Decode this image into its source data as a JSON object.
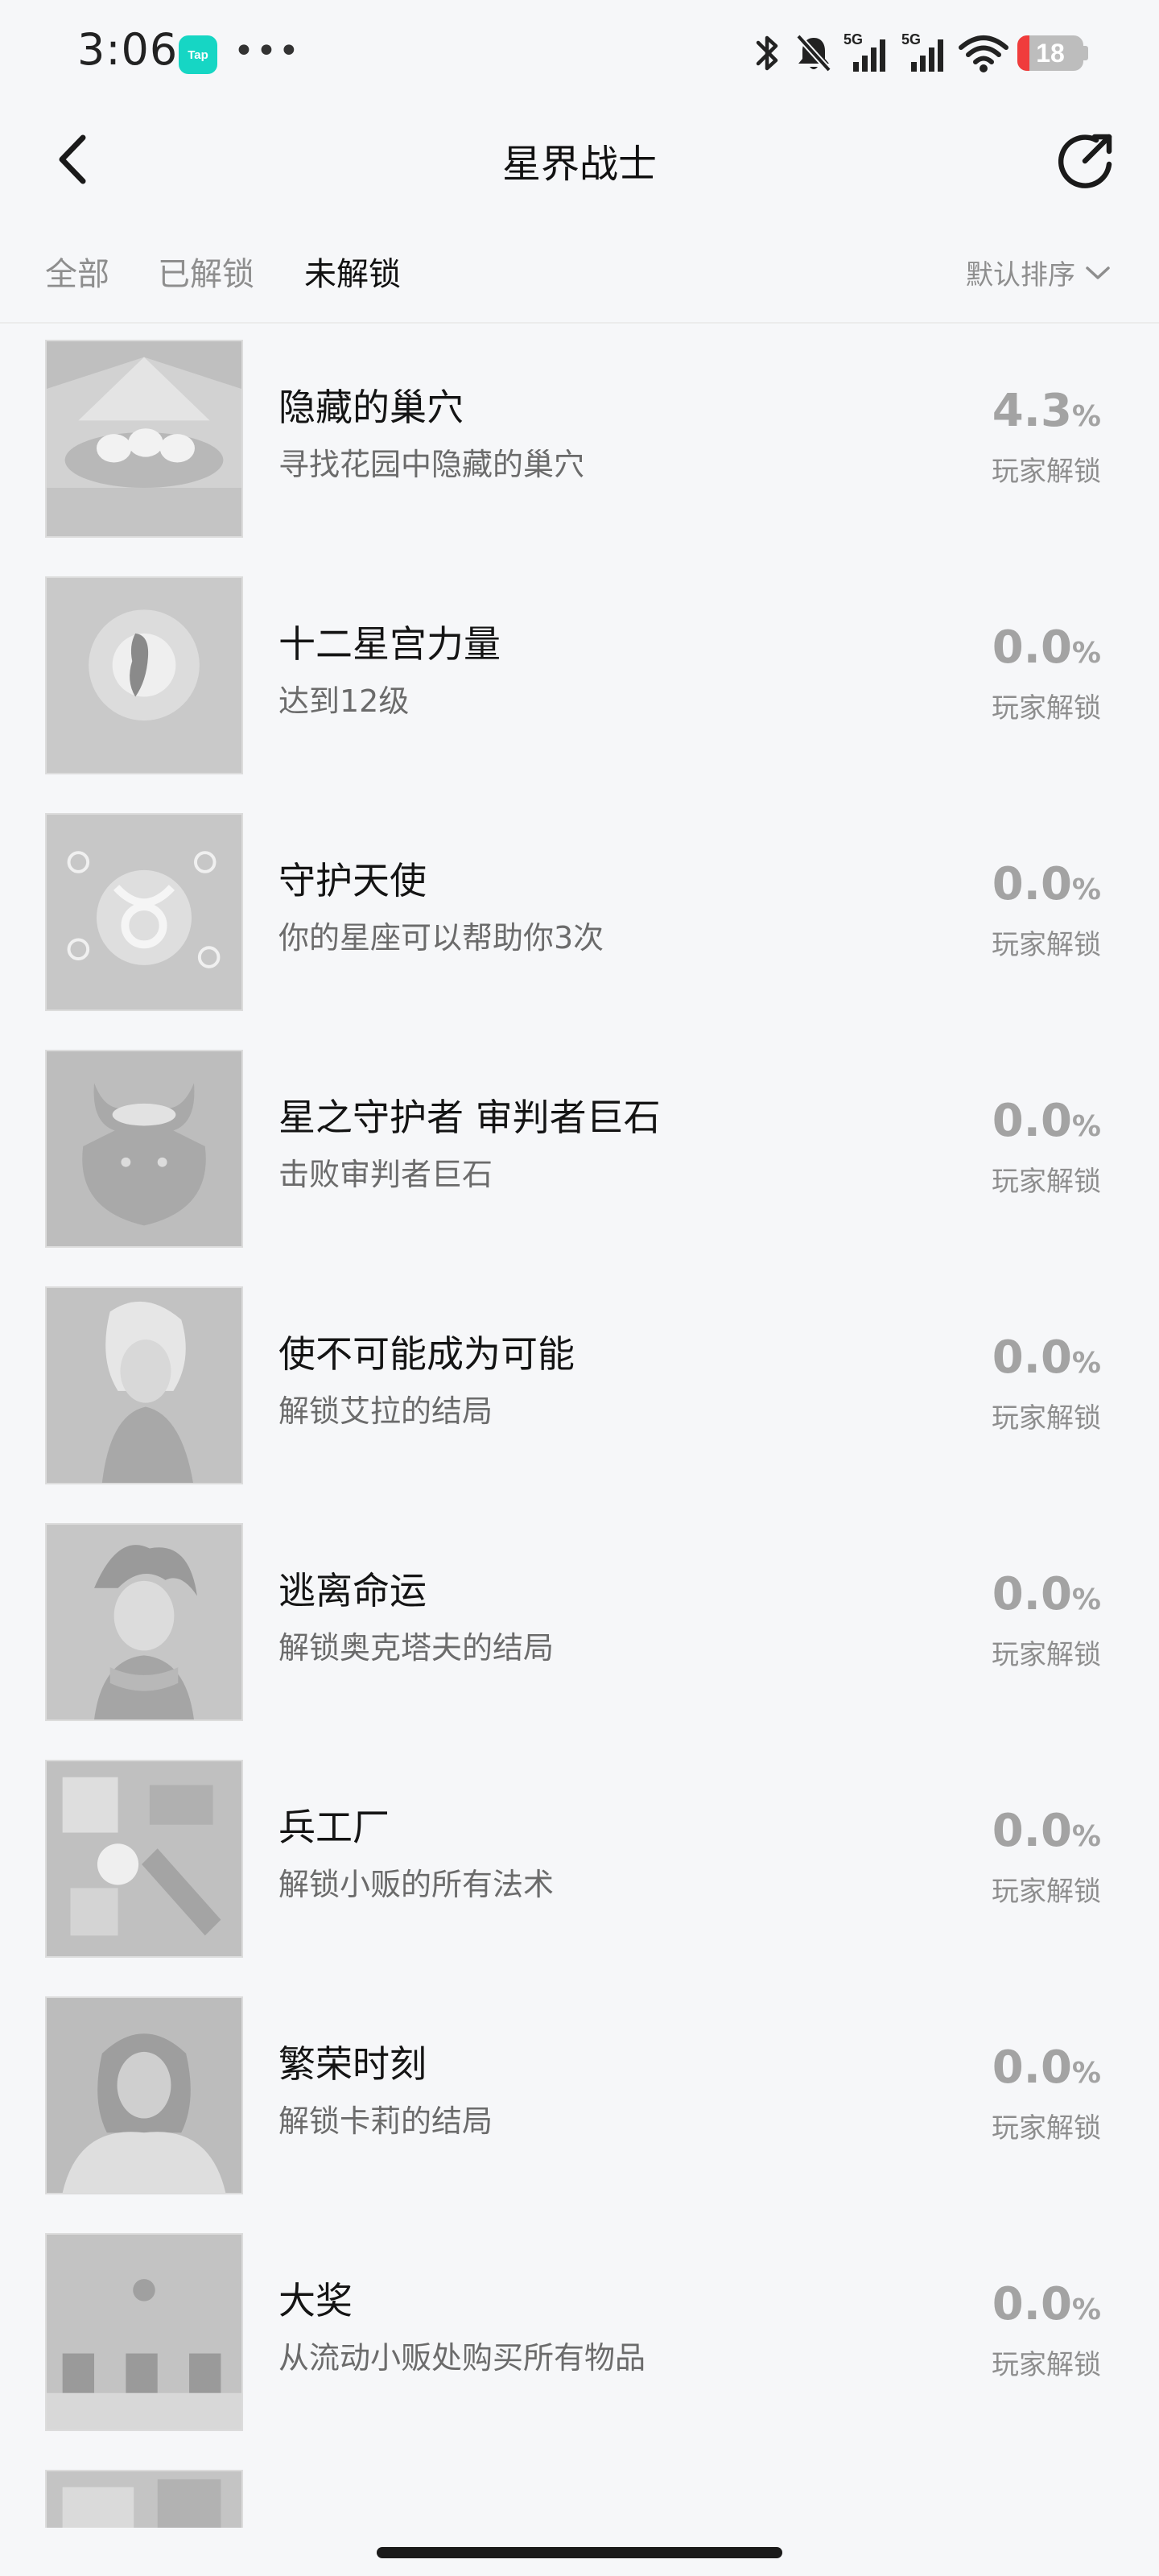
{
  "status_bar": {
    "time": "3:06",
    "app_badge": "Tap",
    "overflow": "•••",
    "network_1": "5G",
    "network_2": "5G",
    "battery": "18",
    "battery_level_percent": 18,
    "icons": [
      "bluetooth-icon",
      "bell-muted-icon",
      "signal-icon",
      "signal-icon",
      "wifi-icon",
      "battery-icon"
    ]
  },
  "header": {
    "title": "星界战士",
    "back_icon": "chevron-left-icon",
    "share_icon": "share-icon"
  },
  "tabs": [
    {
      "label": "全部",
      "active": false
    },
    {
      "label": "已解锁",
      "active": false
    },
    {
      "label": "未解锁",
      "active": true
    }
  ],
  "sort": {
    "label": "默认排序",
    "icon": "chevron-down-icon"
  },
  "achievements": [
    {
      "title": "隐藏的巢穴",
      "desc": "寻找花园中隐藏的巢穴",
      "percent": "4.3",
      "unit": "%",
      "label": "玩家解锁"
    },
    {
      "title": "十二星宫力量",
      "desc": "达到12级",
      "percent": "0.0",
      "unit": "%",
      "label": "玩家解锁"
    },
    {
      "title": "守护天使",
      "desc": "你的星座可以帮助你3次",
      "percent": "0.0",
      "unit": "%",
      "label": "玩家解锁"
    },
    {
      "title": "星之守护者 审判者巨石",
      "desc": "击败审判者巨石",
      "percent": "0.0",
      "unit": "%",
      "label": "玩家解锁"
    },
    {
      "title": "使不可能成为可能",
      "desc": "解锁艾拉的结局",
      "percent": "0.0",
      "unit": "%",
      "label": "玩家解锁"
    },
    {
      "title": "逃离命运",
      "desc": "解锁奥克塔夫的结局",
      "percent": "0.0",
      "unit": "%",
      "label": "玩家解锁"
    },
    {
      "title": "兵工厂",
      "desc": "解锁小贩的所有法术",
      "percent": "0.0",
      "unit": "%",
      "label": "玩家解锁"
    },
    {
      "title": "繁荣时刻",
      "desc": "解锁卡莉的结局",
      "percent": "0.0",
      "unit": "%",
      "label": "玩家解锁"
    },
    {
      "title": "大奖",
      "desc": "从流动小贩处购买所有物品",
      "percent": "0.0",
      "unit": "%",
      "label": "玩家解锁"
    },
    {
      "title": "",
      "desc": "",
      "percent": "",
      "unit": "",
      "label": ""
    }
  ],
  "colors": {
    "background": "#f6f7f9",
    "battery_low": "#f03c3c",
    "tap_brand": "#16d6c4",
    "percent_text": "#a3a3a3"
  }
}
